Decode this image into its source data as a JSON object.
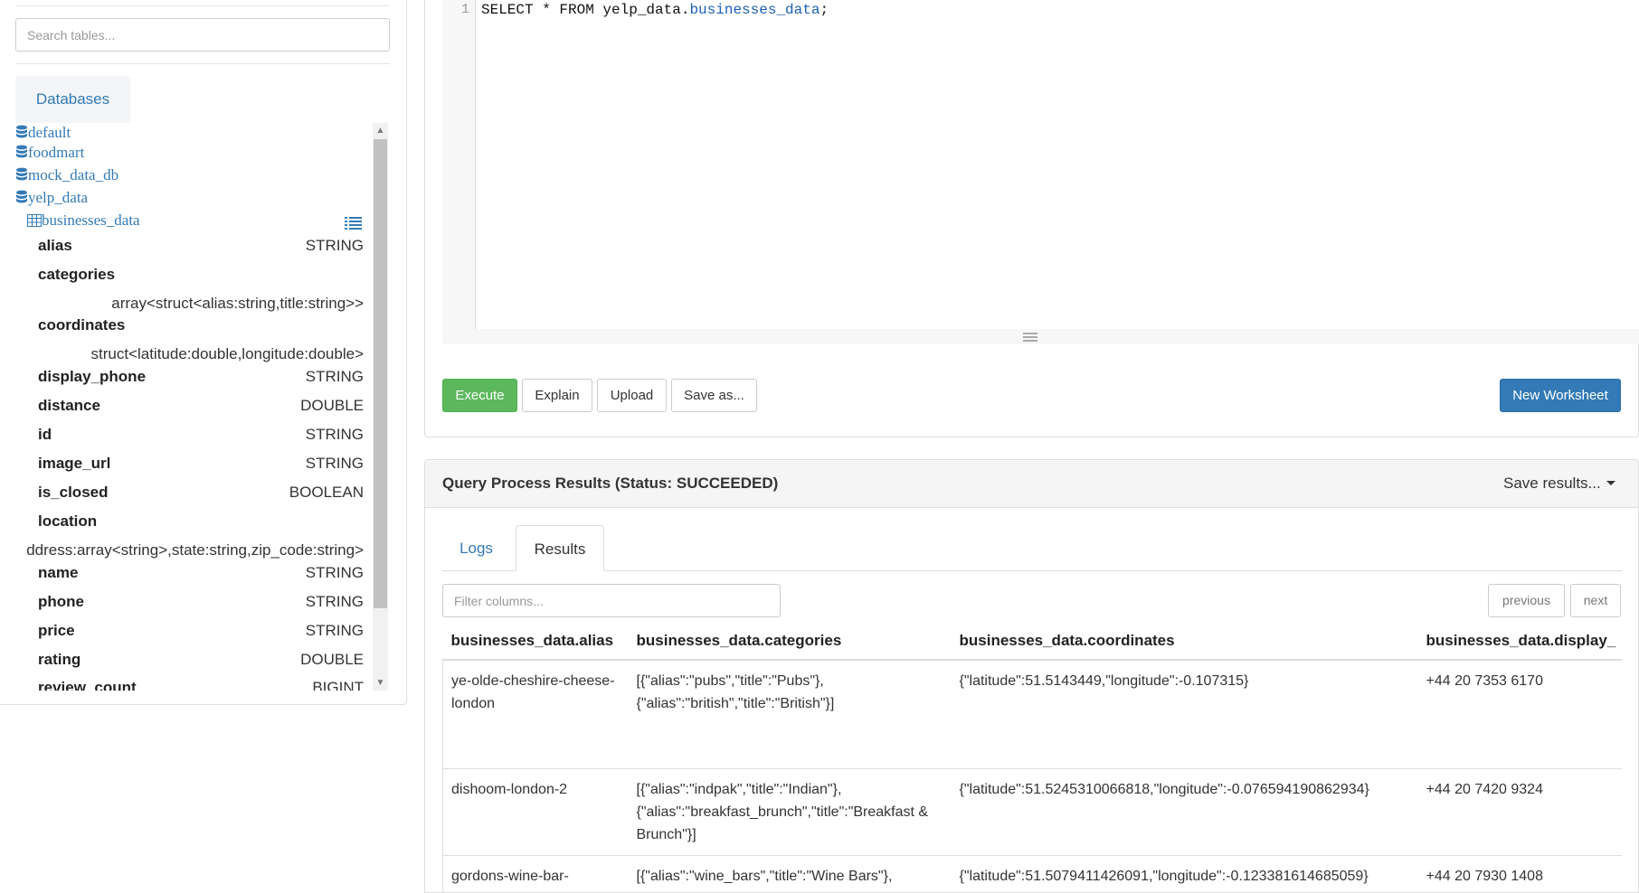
{
  "sidebar": {
    "search_placeholder": "Search tables...",
    "tab_label": "Databases",
    "databases": [
      "default",
      "foodmart",
      "mock_data_db",
      "yelp_data"
    ],
    "table_name": "businesses_data",
    "columns": [
      {
        "name": "alias",
        "type": "STRING"
      },
      {
        "name": "categories",
        "type": "array<struct<alias:string,title:string>>"
      },
      {
        "name": "coordinates",
        "type": "struct<latitude:double,longitude:double>"
      },
      {
        "name": "display_phone",
        "type": "STRING"
      },
      {
        "name": "distance",
        "type": "DOUBLE"
      },
      {
        "name": "id",
        "type": "STRING"
      },
      {
        "name": "image_url",
        "type": "STRING"
      },
      {
        "name": "is_closed",
        "type": "BOOLEAN"
      },
      {
        "name": "location",
        "type": "ddress:array<string>,state:string,zip_code:string>"
      },
      {
        "name": "name",
        "type": "STRING"
      },
      {
        "name": "phone",
        "type": "STRING"
      },
      {
        "name": "price",
        "type": "STRING"
      },
      {
        "name": "rating",
        "type": "DOUBLE"
      },
      {
        "name": "review_count",
        "type": "BIGINT"
      }
    ]
  },
  "editor": {
    "line_number": "1",
    "code_prefix": "SELECT * FROM yelp_data.",
    "code_table": "businesses_data",
    "code_suffix": ";"
  },
  "toolbar": {
    "execute": "Execute",
    "explain": "Explain",
    "upload": "Upload",
    "save_as": "Save as...",
    "new_worksheet": "New Worksheet"
  },
  "results": {
    "title": "Query Process Results (Status: SUCCEEDED)",
    "save_results": "Save results...",
    "tabs": [
      "Logs",
      "Results"
    ],
    "filter_placeholder": "Filter columns...",
    "previous": "previous",
    "next": "next",
    "headers": [
      "businesses_data.alias",
      "businesses_data.categories",
      "businesses_data.coordinates",
      "businesses_data.display_"
    ],
    "rows": [
      [
        "ye-olde-cheshire-cheese-london",
        "[{\"alias\":\"pubs\",\"title\":\"Pubs\"},{\"alias\":\"british\",\"title\":\"British\"}]",
        "{\"latitude\":51.5143449,\"longitude\":-0.107315}",
        "+44 20 7353 6170"
      ],
      [
        "dishoom-london-2",
        "[{\"alias\":\"indpak\",\"title\":\"Indian\"},{\"alias\":\"breakfast_brunch\",\"title\":\"Breakfast & Brunch\"}]",
        "{\"latitude\":51.5245310066818,\"longitude\":-0.076594190862934}",
        "+44 20 7420 9324"
      ],
      [
        "gordons-wine-bar-",
        "[{\"alias\":\"wine_bars\",\"title\":\"Wine Bars\"},",
        "{\"latitude\":51.5079411426091,\"longitude\":-0.123381614685059}",
        "+44 20 7930 1408"
      ]
    ]
  },
  "colors": {
    "link": "#337ab7",
    "execute_green": "#5cb85c",
    "primary_blue": "#337ab7"
  },
  "icons": {
    "database": "database-icon",
    "table": "table-icon",
    "list": "list-icon",
    "caret": "caret-down-icon"
  }
}
